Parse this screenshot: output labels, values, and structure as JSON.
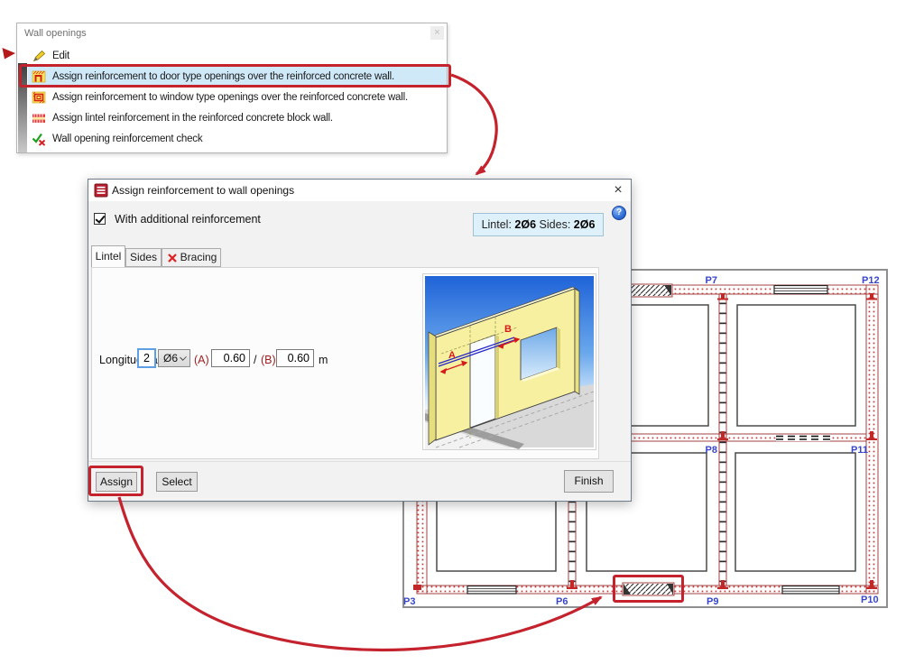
{
  "colors": {
    "accent_red": "#c4232e",
    "highlight_blue": "#cfe9f9",
    "label_blue": "#3847c8",
    "wall_red": "#a34040",
    "info_bg": "#def1fa"
  },
  "menu": {
    "title": "Wall openings",
    "close": "×",
    "items": [
      {
        "icon": "pencil-icon",
        "label": "Edit"
      },
      {
        "icon": "door-opening-icon",
        "label": "Assign reinforcement to door type openings over the reinforced concrete wall."
      },
      {
        "icon": "window-opening-icon",
        "label": "Assign reinforcement to window type openings over the reinforced concrete wall."
      },
      {
        "icon": "lintel-icon",
        "label": "Assign lintel reinforcement in the reinforced concrete block wall."
      },
      {
        "icon": "check-x-icon",
        "label": "Wall opening reinforcement check"
      }
    ]
  },
  "dialog": {
    "title": "Assign reinforcement to wall openings",
    "close": "×",
    "help": "?",
    "checkbox_label": "With additional reinforcement",
    "summary": {
      "lintel_label": "Lintel:",
      "lintel_value": "2Ø6",
      "sides_label": "Sides:",
      "sides_value": "2Ø6"
    },
    "tabs": [
      {
        "label": "Lintel"
      },
      {
        "label": "Sides"
      },
      {
        "label": "Bracing"
      }
    ],
    "form": {
      "longitudinal_label": "Longitudinal:",
      "bar_count": "2",
      "bar_diameter": "Ø6",
      "a_label": "(A)",
      "a_value": "0.60",
      "separator": "/",
      "b_label": "(B)",
      "b_value": "0.60",
      "unit_label": "m"
    },
    "illustration": {
      "dim_a": "A",
      "dim_b": "B"
    },
    "buttons": {
      "assign": "Assign",
      "select": "Select",
      "finish": "Finish"
    }
  },
  "plan": {
    "labels": {
      "p7": "P7",
      "p12": "P12",
      "p8": "P8",
      "p11": "P11",
      "p3": "P3",
      "p6": "P6",
      "p9": "P9",
      "p10": "P10"
    }
  }
}
